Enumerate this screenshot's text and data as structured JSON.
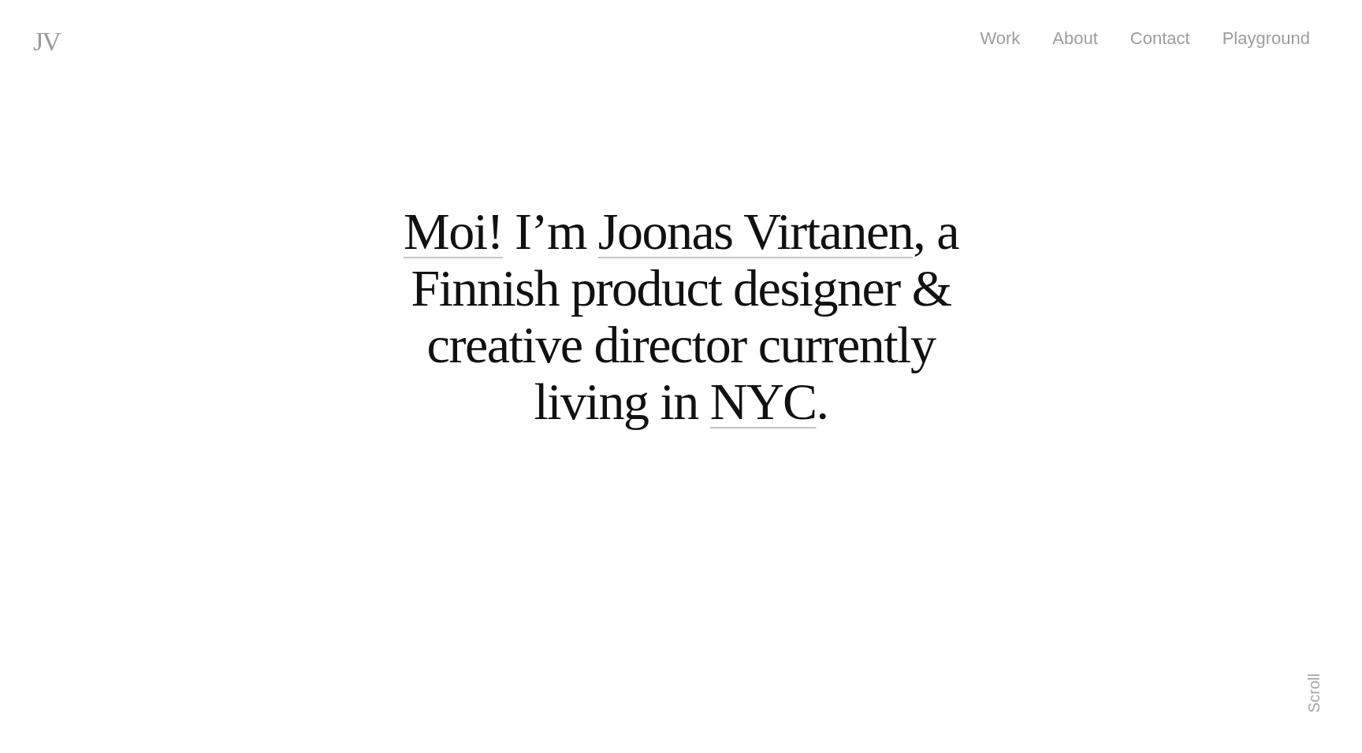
{
  "header": {
    "logo": "JV",
    "nav": [
      "Work",
      "About",
      "Contact",
      "Playground"
    ]
  },
  "intro": {
    "lines": [
      {
        "parts": [
          {
            "kind": "link",
            "text": "Moi!"
          },
          {
            "kind": "text",
            "text": " I’m "
          },
          {
            "kind": "link",
            "text": "Joonas Virtanen"
          },
          {
            "kind": "text",
            "text": ", a"
          }
        ]
      },
      {
        "parts": [
          {
            "kind": "text",
            "text": "Finnish product designer &"
          }
        ]
      },
      {
        "parts": [
          {
            "kind": "text",
            "text": "creative director currently"
          }
        ]
      },
      {
        "parts": [
          {
            "kind": "text",
            "text": "living in "
          },
          {
            "kind": "link",
            "text": "NYC"
          },
          {
            "kind": "text",
            "text": "."
          }
        ]
      }
    ]
  },
  "scroll_hint": "Scroll"
}
